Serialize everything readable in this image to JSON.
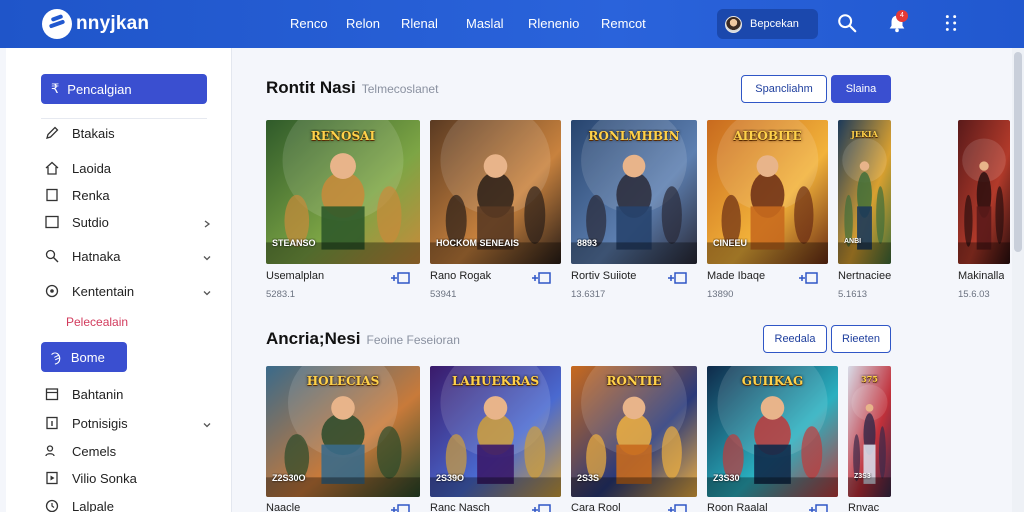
{
  "app": {
    "logo_text": "nnyjkan"
  },
  "nav": [
    "Renco",
    "Relon",
    "Rlenal",
    "Maslal",
    "Rlenenio",
    "Remcot"
  ],
  "user": {
    "name": "Bepcekan",
    "notification_count": "4"
  },
  "sidebar": {
    "primary_label": "Pencalgian",
    "items": [
      {
        "label": "Btakais",
        "icon": "pencil-icon",
        "chevron": false
      },
      {
        "label": "Laoida",
        "icon": "home-icon",
        "chevron": false
      },
      {
        "label": "Renka",
        "icon": "square-icon",
        "chevron": false
      },
      {
        "label": "Sutdio",
        "icon": "square-icon",
        "chevron": true
      },
      {
        "label": "Hatnaka",
        "icon": "search-icon",
        "chevron": true
      },
      {
        "label": "Kententain",
        "icon": "gear-icon",
        "chevron": true
      }
    ],
    "sub_item": "Pelecealain",
    "active_label": "Bome",
    "bottom_items": [
      {
        "label": "Bahtanin",
        "icon": "calendar-icon",
        "chevron": false
      },
      {
        "label": "Potnisigis",
        "icon": "info-icon",
        "chevron": true
      },
      {
        "label": "Cemels",
        "icon": "people-icon",
        "chevron": false
      },
      {
        "label": "Vilio Sonka",
        "icon": "video-icon",
        "chevron": false
      },
      {
        "label": "Lalpale",
        "icon": "clock-icon",
        "chevron": false
      }
    ]
  },
  "section1": {
    "title": "Rontit Nasi",
    "subtitle": "Telmecoslanet",
    "btn_outline": "Spancliahm",
    "btn_solid": "Slaina",
    "cards": [
      {
        "title": "Usemalplan",
        "meta": "5283.1",
        "art_top": "RENOSAI",
        "art_bottom": "STEANSO",
        "palette": [
          "#2f5a2a",
          "#7da545",
          "#c98a3a"
        ]
      },
      {
        "title": "Rano Rogak",
        "meta": "53941",
        "art_top": "",
        "art_bottom": "HOCKOM SENEAIS",
        "palette": [
          "#5a3a22",
          "#c8823e",
          "#2a1e18"
        ]
      },
      {
        "title": "Rortiv Suiiote",
        "meta": "13.6317",
        "art_top": "RONLMHBIN",
        "art_bottom": "8893",
        "palette": [
          "#27446e",
          "#5d7fb0",
          "#2a2a38"
        ]
      },
      {
        "title": "Made Ibaqe",
        "meta": "13890",
        "art_top": "AIEOBITE",
        "art_bottom": "CINEEU",
        "palette": [
          "#c86a1e",
          "#f2b23a",
          "#6a2c14"
        ]
      },
      {
        "title": "Nertnaciee",
        "meta": "5.1613",
        "art_top": "JEKIA",
        "art_bottom": "ANBI",
        "palette": [
          "#1c3a5a",
          "#d9a030",
          "#3f6e3a"
        ]
      },
      {
        "title": "Makinalla",
        "meta": "15.6.03",
        "art_top": "",
        "art_bottom": "",
        "palette": [
          "#5a1a1a",
          "#b23a2a",
          "#2a0e0e"
        ]
      }
    ]
  },
  "section2": {
    "title": "Ancria;Nesi",
    "subtitle": "Feoine Feseioran",
    "btn_outline_a": "Reedala",
    "btn_outline_b": "Rieeten",
    "cards": [
      {
        "title": "Naacle",
        "meta": "",
        "art_top": "HOLECIAS",
        "art_bottom": "Z2S30O",
        "palette": [
          "#3a6a8a",
          "#c87a3a",
          "#2a4a2a"
        ]
      },
      {
        "title": "Ranc Nasch",
        "meta": "",
        "art_top": "LAHUEKRAS",
        "art_bottom": "2S39O",
        "palette": [
          "#3a1a6a",
          "#4a6ad0",
          "#d0a03a"
        ]
      },
      {
        "title": "Cara Rool",
        "meta": "",
        "art_top": "RONTIE",
        "art_bottom": "2S3S",
        "palette": [
          "#c86a1e",
          "#2a3a7a",
          "#f0b040"
        ]
      },
      {
        "title": "Roon Raalal",
        "meta": "",
        "art_top": "GUIIKAG",
        "art_bottom": "Z3S30",
        "palette": [
          "#0f2a4a",
          "#2ab0c0",
          "#c03a3a"
        ]
      },
      {
        "title": "Rnvac",
        "meta": "",
        "art_top": "375",
        "art_bottom": "Z3S3",
        "palette": [
          "#d8dce8",
          "#c0303a",
          "#3a2a4a"
        ]
      }
    ]
  }
}
